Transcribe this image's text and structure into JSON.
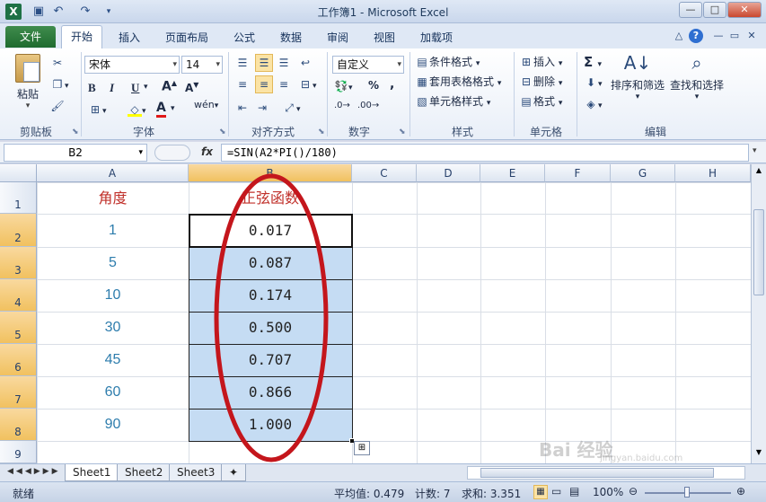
{
  "window": {
    "title": "工作簿1 - Microsoft Excel"
  },
  "tabs": {
    "file": "文件",
    "items": [
      "开始",
      "插入",
      "页面布局",
      "公式",
      "数据",
      "审阅",
      "视图",
      "加载项"
    ]
  },
  "ribbon": {
    "clipboard": {
      "paste": "粘贴",
      "label": "剪贴板"
    },
    "font": {
      "name": "宋体",
      "size": "14",
      "label": "字体",
      "bold": "B",
      "italic": "I",
      "underline": "U",
      "grow": "A",
      "shrink": "A",
      "wen": "wén"
    },
    "align": {
      "label": "对齐方式"
    },
    "number": {
      "format": "自定义",
      "label": "数字",
      "percent": "%",
      "comma": ","
    },
    "styles": {
      "cond": "条件格式",
      "table": "套用表格格式",
      "cell": "单元格样式",
      "label": "样式"
    },
    "cells": {
      "insert": "插入",
      "delete": "删除",
      "format": "格式",
      "label": "单元格"
    },
    "editing": {
      "sort": "排序和筛选",
      "find": "查找和选择",
      "label": "编辑"
    }
  },
  "formula_bar": {
    "name_box": "B2",
    "fx": "fx",
    "formula": "=SIN(A2*PI()/180)"
  },
  "columns": [
    "A",
    "B",
    "C",
    "D",
    "E",
    "F",
    "G",
    "H"
  ],
  "rows": [
    "1",
    "2",
    "3",
    "4",
    "5",
    "6",
    "7",
    "8",
    "9"
  ],
  "headers": {
    "a1": "角度",
    "b1": "正弦函数"
  },
  "data": [
    {
      "a": "1",
      "b": "0.017"
    },
    {
      "a": "5",
      "b": "0.087"
    },
    {
      "a": "10",
      "b": "0.174"
    },
    {
      "a": "30",
      "b": "0.500"
    },
    {
      "a": "45",
      "b": "0.707"
    },
    {
      "a": "60",
      "b": "0.866"
    },
    {
      "a": "90",
      "b": "1.000"
    }
  ],
  "sheets": [
    "Sheet1",
    "Sheet2",
    "Sheet3"
  ],
  "status": {
    "ready": "就绪",
    "average": "平均值: 0.479",
    "count": "计数: 7",
    "sum": "求和: 3.351",
    "zoom": "100%"
  },
  "colors": {
    "selection": "#c5dcf3",
    "annotation": "#c4161c",
    "excel_green": "#1e7145"
  }
}
